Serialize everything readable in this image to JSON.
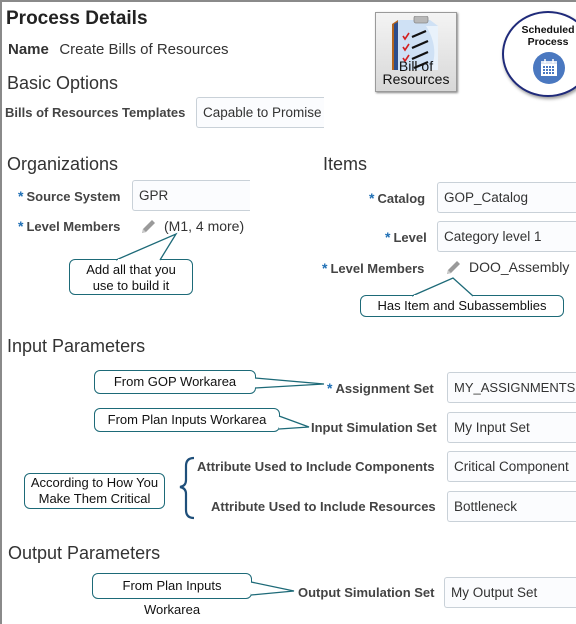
{
  "header": {
    "title": "Process Details",
    "name_label": "Name",
    "name_value": "Create Bills of Resources"
  },
  "badges": {
    "bill_of_resources": {
      "line1": "Bill of",
      "line2": "Resources",
      "icon": "clipboard-checklist-icon"
    },
    "scheduled_process": {
      "line1": "Scheduled",
      "line2": "Process",
      "icon": "calendar-icon"
    }
  },
  "basic_options": {
    "heading": "Basic Options",
    "templates_label": "Bills of Resources Templates",
    "templates_value": "Capable to Promise"
  },
  "organizations": {
    "heading": "Organizations",
    "source_system_label": "Source System",
    "source_system_value": "GPR",
    "level_members_label": "Level Members",
    "level_members_value": "(M1, 4 more)",
    "callout": {
      "line1": "Add all that you",
      "line2": "use to build it"
    }
  },
  "items": {
    "heading": "Items",
    "catalog_label": "Catalog",
    "catalog_value": "GOP_Catalog",
    "level_label": "Level",
    "level_value": "Category level 1",
    "level_members_label": "Level Members",
    "level_members_value": "DOO_Assembly",
    "callout": "Has Item and Subassemblies"
  },
  "input_parameters": {
    "heading": "Input Parameters",
    "assignment_set_label": "Assignment Set",
    "assignment_set_value": "MY_ASSIGNMENTS",
    "assignment_callout": "From GOP Workarea",
    "input_sim_label": "Input Simulation Set",
    "input_sim_value": "My Input Set",
    "input_sim_callout": "From Plan Inputs Workarea",
    "components_label": "Attribute Used to Include Components",
    "components_value": "Critical Component",
    "resources_label": "Attribute Used to Include Resources",
    "resources_value": "Bottleneck",
    "critical_callout": {
      "line1": "According to How You",
      "line2": "Make Them Critical"
    }
  },
  "output_parameters": {
    "heading": "Output Parameters",
    "output_sim_label": "Output Simulation Set",
    "output_sim_value": "My Output Set",
    "output_sim_callout": "From Plan Inputs Workarea"
  },
  "required_marker": "*"
}
